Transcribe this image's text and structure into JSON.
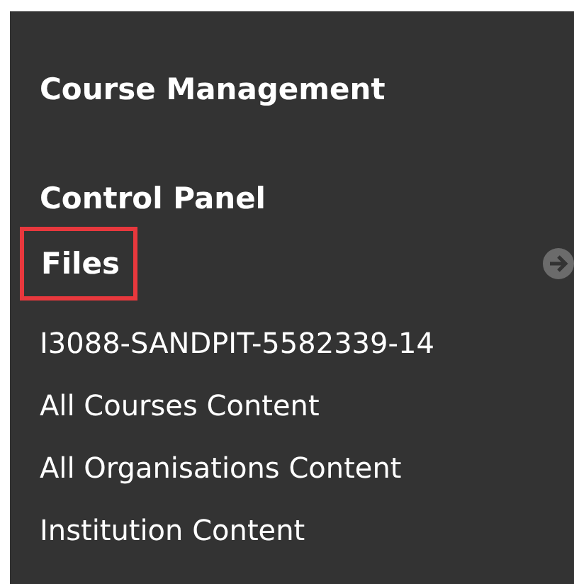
{
  "heading": "Course Management",
  "section": {
    "title": "Control Panel"
  },
  "files": {
    "label": "Files",
    "highlighted": true
  },
  "items": [
    "I3088-SANDPIT-5582339-14",
    "All Courses Content",
    "All Organisations Content",
    "Institution Content"
  ]
}
